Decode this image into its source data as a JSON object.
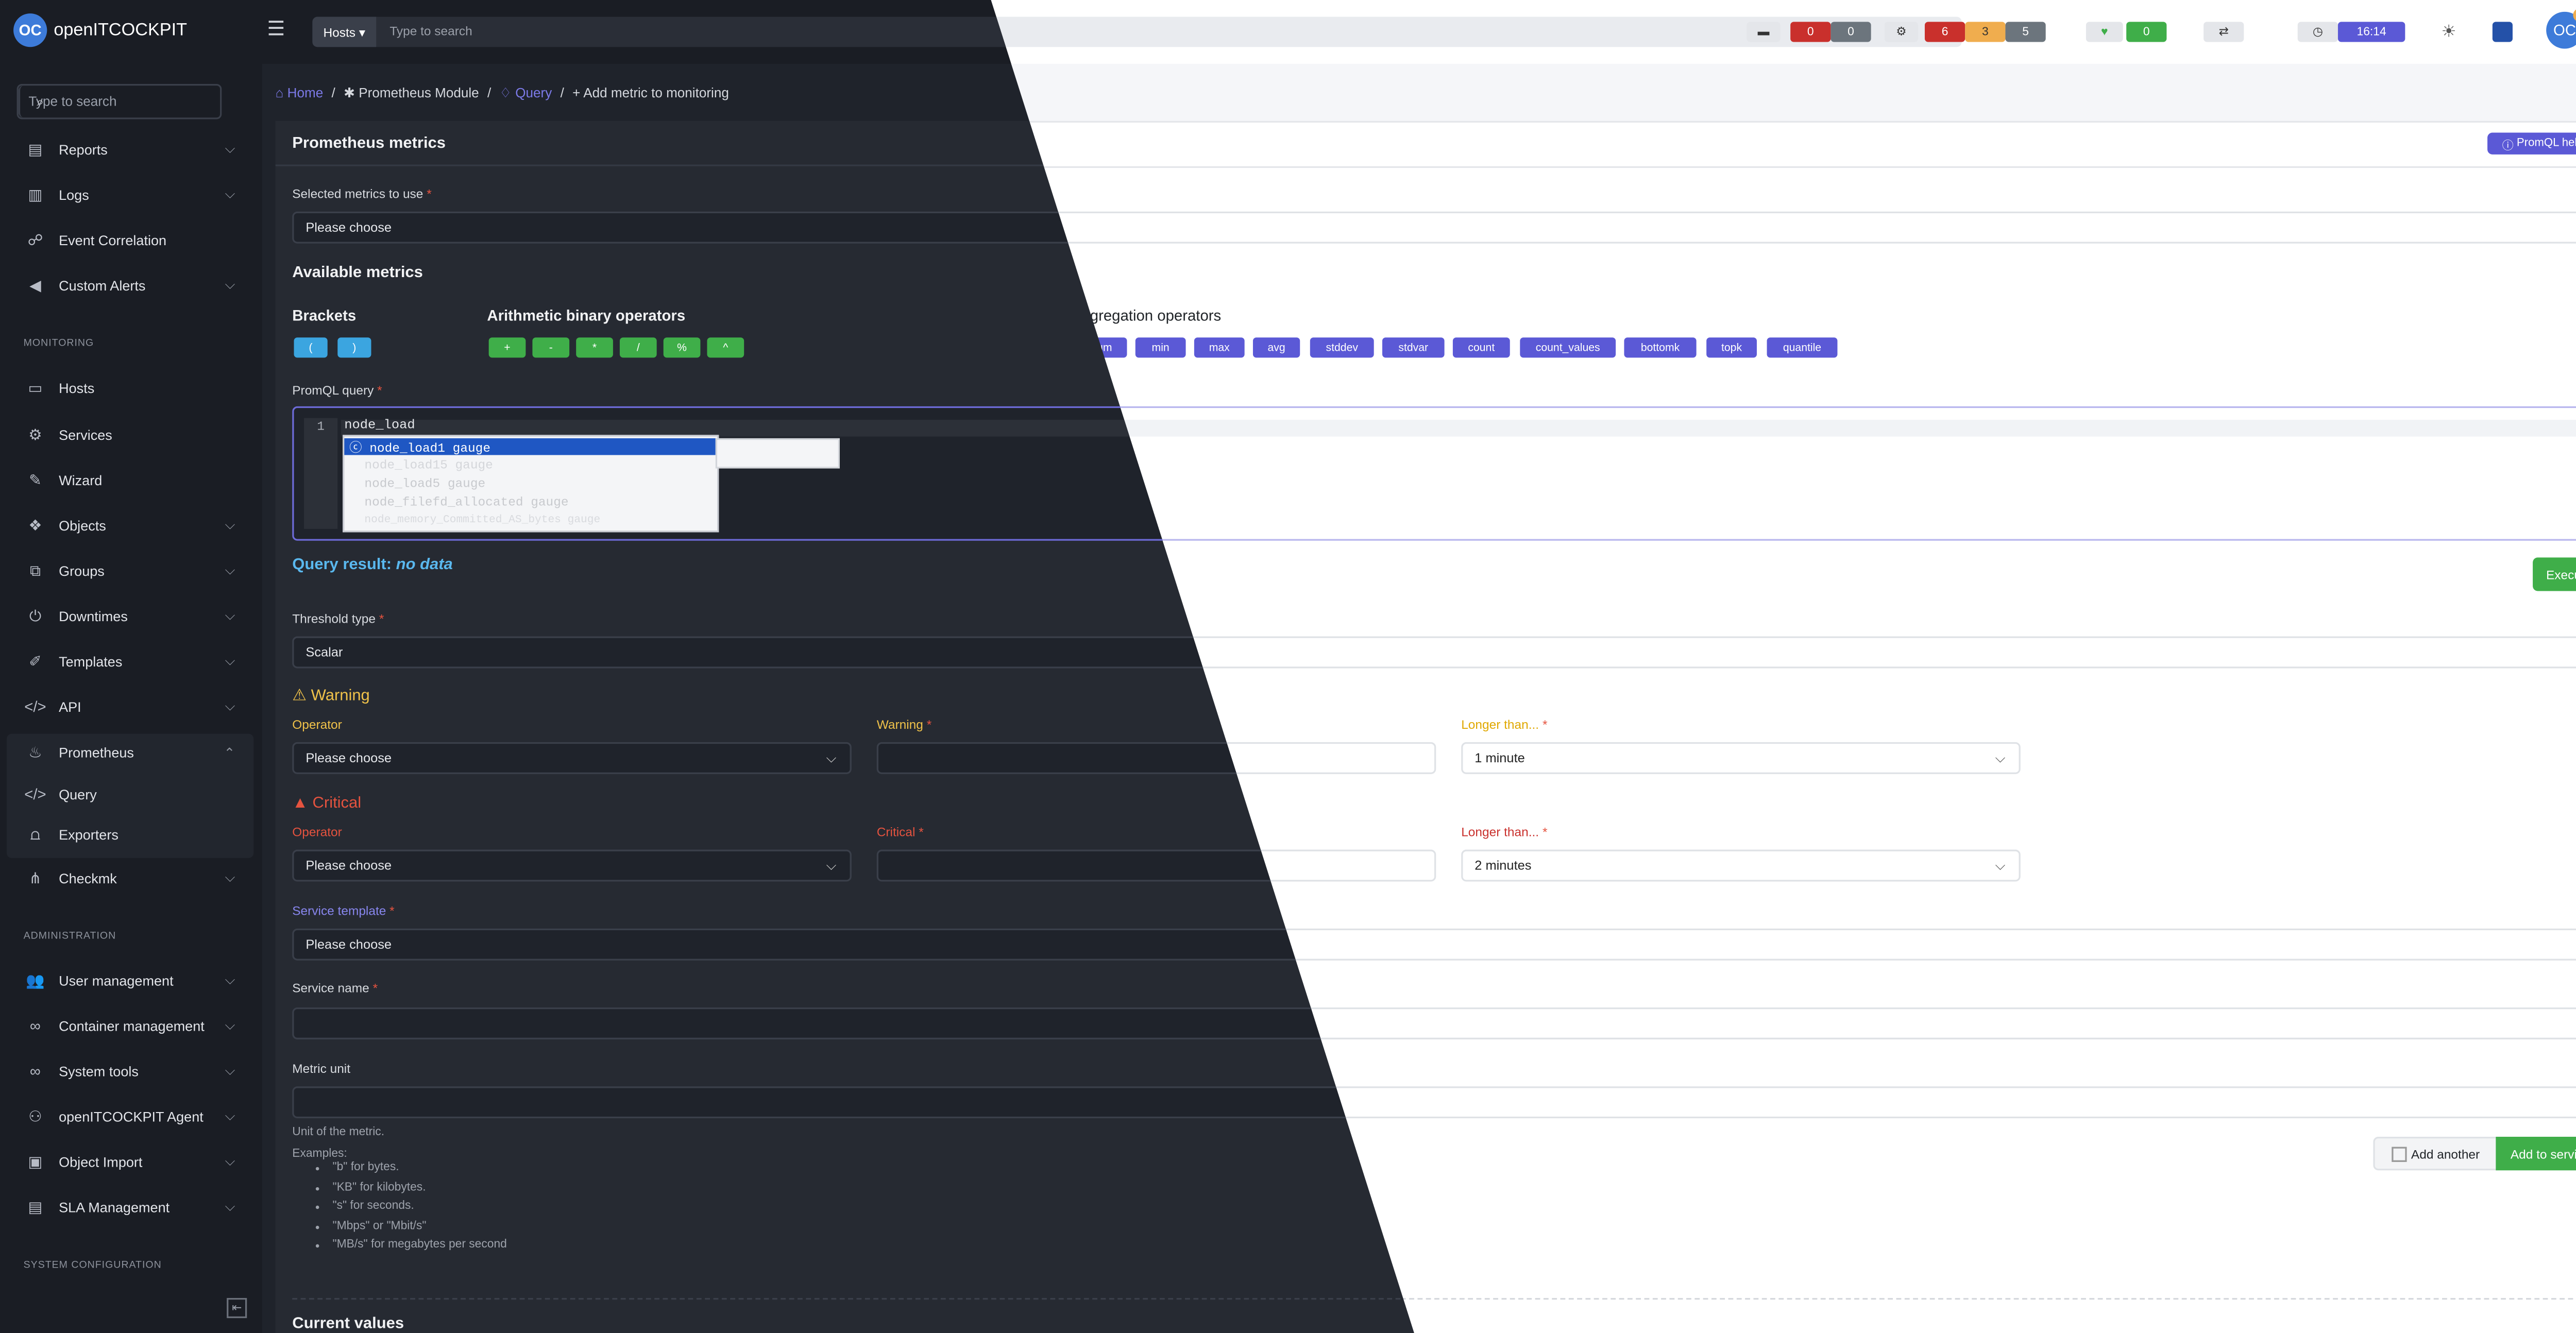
{
  "app": {
    "name": "openITCOCKPIT",
    "logo_text": "OC"
  },
  "sidebar": {
    "search_placeholder": "Type to search",
    "items": [
      {
        "label": "Reports",
        "icon": "report-icon"
      },
      {
        "label": "Logs",
        "icon": "document-icon"
      },
      {
        "label": "Event Correlation",
        "icon": "sitemap-icon"
      },
      {
        "label": "Custom Alerts",
        "icon": "megaphone-icon"
      }
    ],
    "group_monitoring": "MONITORING",
    "monitoring_items": [
      {
        "label": "Hosts"
      },
      {
        "label": "Services"
      },
      {
        "label": "Wizard"
      },
      {
        "label": "Objects"
      },
      {
        "label": "Groups"
      },
      {
        "label": "Downtimes"
      },
      {
        "label": "Templates"
      },
      {
        "label": "API"
      },
      {
        "label": "Prometheus"
      }
    ],
    "prometheus_sub": [
      {
        "label": "Query"
      },
      {
        "label": "Exporters"
      }
    ],
    "checkmk": "Checkmk",
    "group_admin": "ADMINISTRATION",
    "admin_items": [
      {
        "label": "User management"
      },
      {
        "label": "Container management"
      },
      {
        "label": "System tools"
      },
      {
        "label": "openITCOCKPIT Agent"
      },
      {
        "label": "Object Import"
      },
      {
        "label": "SLA Management"
      }
    ],
    "group_sysconf": "SYSTEM CONFIGURATION"
  },
  "topbar": {
    "hosts_dropdown": "Hosts",
    "search_placeholder": "Type to search",
    "host_counts": [
      "0",
      "0"
    ],
    "service_counts": [
      "6",
      "3",
      "5"
    ],
    "ok_count": "0",
    "time": "16:14"
  },
  "breadcrumb": {
    "home": "Home",
    "module": "Prometheus Module",
    "query": "Query",
    "current": "Add metric to monitoring",
    "sep": "/"
  },
  "card": {
    "title": "Prometheus metrics",
    "help_button": "PromQL help",
    "selected_metrics_label": "Selected metrics to use",
    "selected_metrics_value": "Please choose",
    "available_metrics": "Available metrics",
    "brackets_label": "Brackets",
    "brackets": [
      "(",
      ")"
    ],
    "arith_label": "Arithmetic binary operators",
    "arith": [
      "+",
      "-",
      "*",
      "/",
      "%",
      "^"
    ],
    "agg_label": "Aggregation operators",
    "agg": [
      "sum",
      "min",
      "max",
      "avg",
      "stddev",
      "stdvar",
      "count",
      "count_values",
      "bottomk",
      "topk",
      "quantile"
    ],
    "promql_label": "PromQL query",
    "editor_line_no": "1",
    "editor_text": "node_load",
    "autocomplete": [
      "node_load1 gauge",
      "node_load15 gauge",
      "node_load5 gauge",
      "node_filefd_allocated gauge",
      "node_memory_Committed_AS_bytes gauge"
    ],
    "query_result_label": "Query result:",
    "query_result_value": "no data",
    "execute": "Execute",
    "threshold_label": "Threshold type",
    "threshold_value": "Scalar",
    "warning_title": "Warning",
    "operator_label": "Operator",
    "operator_value": "Please choose",
    "warning_label": "Warning",
    "longer_than_label": "Longer than...",
    "warning_longer_value": "1 minute",
    "critical_title": "Critical",
    "critical_label": "Critical",
    "critical_longer_value": "2 minutes",
    "service_template_label": "Service template",
    "service_template_value": "Please choose",
    "service_name_label": "Service name",
    "metric_unit_label": "Metric unit",
    "unit_help": "Unit of the metric.",
    "examples_label": "Examples:",
    "examples": [
      "\"b\" for bytes.",
      "\"KB\" for kilobytes.",
      "\"s\" for seconds.",
      "\"Mbps\" or \"Mbit/s\"",
      "\"MB/s\" for megabytes per second"
    ],
    "add_another": "Add another",
    "add_to_service": "Add to service",
    "current_values": "Current values"
  },
  "colors": {
    "accent": "#5b59d6",
    "success": "#3fae49",
    "danger": "#c9302c",
    "warning": "#f0ad4e",
    "dark": "#1a1d24"
  }
}
